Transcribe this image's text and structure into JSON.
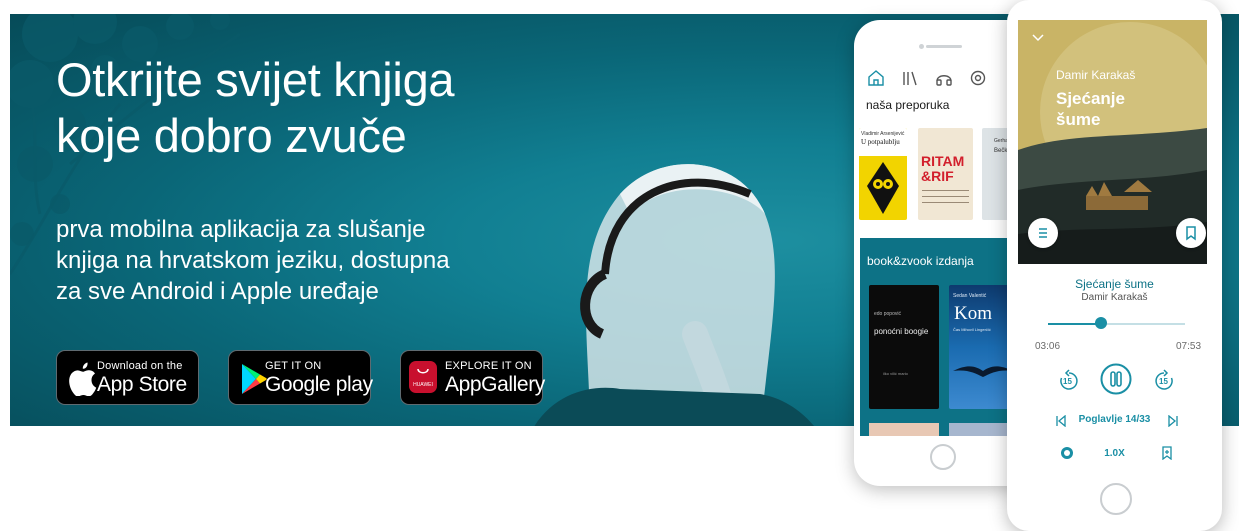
{
  "hero": {
    "headline": [
      "Otkrijte svijet knjiga",
      "koje dobro zvuče"
    ],
    "subtitle": [
      "prva mobilna aplikacija za slušanje",
      "knjiga na hrvatskom jeziku, dostupna",
      "za sve Android i Apple uređaje"
    ]
  },
  "stores": [
    {
      "small": "Download on the",
      "big": "App Store",
      "icon": "apple-icon"
    },
    {
      "small": "GET IT ON",
      "big": "Google play",
      "icon": "google-play-icon"
    },
    {
      "small": "EXPLORE IT ON",
      "big": "AppGallery",
      "icon": "huawei-icon",
      "icon_text": "HUAWEI"
    }
  ],
  "phone1": {
    "nav": [
      "home-icon",
      "library-icon",
      "headphones-icon",
      "settings-icon"
    ],
    "sections": {
      "recommended": "naša preporuka",
      "editions": "book&zvook izdanja"
    },
    "books": [
      {
        "author": "Vladimir Arsenijević",
        "title": "U potpalublju"
      },
      {
        "title": "RITAM &RIF"
      },
      {
        "author": "Gerhard",
        "title": "Bečki"
      },
      {
        "author": "edo popović",
        "title": "ponoćni boogie",
        "footer": "ilko vilić mario"
      },
      {
        "author": "Sedan Valentić",
        "title": "Kom",
        "subtitle": "Čas Mihovil Lingerčić"
      }
    ]
  },
  "phone2": {
    "cover": {
      "author": "Damir Karakaš",
      "title": [
        "Sjećanje",
        "šume"
      ]
    },
    "track_title": "Sjećanje šume",
    "track_author": "Damir Karakaš",
    "elapsed": "03:06",
    "duration": "07:53",
    "progress": 0.39,
    "skip_back": "15",
    "skip_forward": "15",
    "chapter": "Poglavlje 14/33",
    "speed": "1.0X"
  },
  "colors": {
    "accent": "#1a8fa5",
    "banner": "#0d7286",
    "huawei": "#c8102e"
  }
}
